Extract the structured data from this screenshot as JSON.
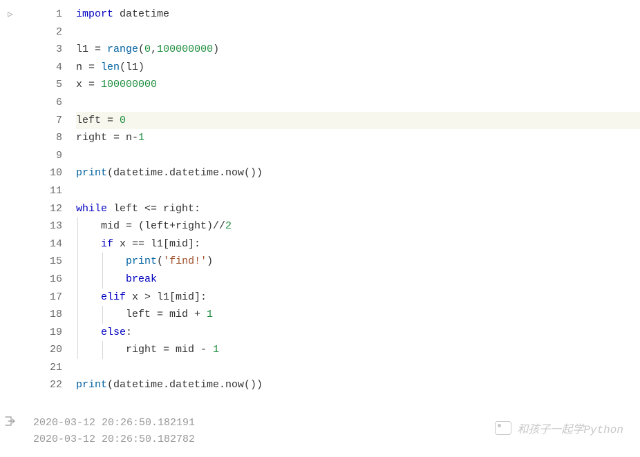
{
  "code": {
    "lines": [
      {
        "n": 1,
        "html": "<span class='tok-kw'>import</span> datetime"
      },
      {
        "n": 2,
        "html": ""
      },
      {
        "n": 3,
        "html": "l1 = <span class='tok-builtin'>range</span>(<span class='tok-num'>0</span>,<span class='tok-num'>100000000</span>)"
      },
      {
        "n": 4,
        "html": "n = <span class='tok-builtin'>len</span>(l1)"
      },
      {
        "n": 5,
        "html": "x = <span class='tok-num'>100000000</span>"
      },
      {
        "n": 6,
        "html": ""
      },
      {
        "n": 7,
        "html": "left = <span class='tok-num'>0</span>",
        "hl": true
      },
      {
        "n": 8,
        "html": "right = n-<span class='tok-num'>1</span>"
      },
      {
        "n": 9,
        "html": ""
      },
      {
        "n": 10,
        "html": "<span class='tok-builtin'>print</span>(datetime.datetime.now())"
      },
      {
        "n": 11,
        "html": ""
      },
      {
        "n": 12,
        "html": "<span class='tok-kw'>while</span> left &lt;= right:"
      },
      {
        "n": 13,
        "html": "    mid = (left+right)//<span class='tok-num'>2</span>",
        "guides": [
          1
        ]
      },
      {
        "n": 14,
        "html": "    <span class='tok-kw'>if</span> x == l1[mid]:",
        "guides": [
          1
        ]
      },
      {
        "n": 15,
        "html": "        <span class='tok-builtin'>print</span>(<span class='tok-str'>'find!'</span>)",
        "guides": [
          1,
          2
        ]
      },
      {
        "n": 16,
        "html": "        <span class='tok-kw'>break</span>",
        "guides": [
          1,
          2
        ]
      },
      {
        "n": 17,
        "html": "    <span class='tok-kw'>elif</span> x &gt; l1[mid]:",
        "guides": [
          1
        ]
      },
      {
        "n": 18,
        "html": "        left = mid + <span class='tok-num'>1</span>",
        "guides": [
          1,
          2
        ]
      },
      {
        "n": 19,
        "html": "    <span class='tok-kw'>else</span>:",
        "guides": [
          1
        ]
      },
      {
        "n": 20,
        "html": "        right = mid - <span class='tok-num'>1</span>",
        "guides": [
          1,
          2
        ]
      },
      {
        "n": 21,
        "html": ""
      },
      {
        "n": 22,
        "html": "<span class='tok-builtin'>print</span>(datetime.datetime.now())"
      }
    ]
  },
  "output": {
    "lines": [
      "2020-03-12 20:26:50.182191",
      "2020-03-12 20:26:50.182782"
    ]
  },
  "watermark": {
    "text": "和孩子一起学Python"
  },
  "icons": {
    "run": "▷",
    "output": "[→"
  }
}
